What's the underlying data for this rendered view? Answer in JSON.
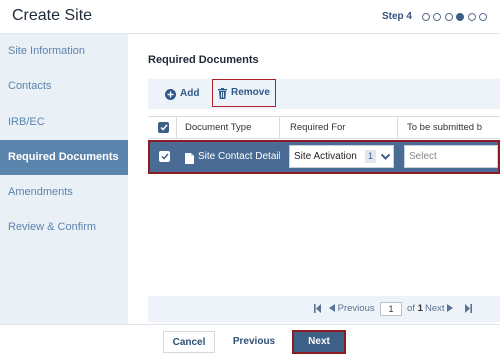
{
  "header": {
    "title": "Create Site",
    "step_label": "Step 4",
    "steps_total": 6,
    "current_step": 4
  },
  "sidebar": {
    "items": [
      {
        "label": "Site Information",
        "active": false
      },
      {
        "label": "Contacts",
        "active": false
      },
      {
        "label": "IRB/EC",
        "active": false
      },
      {
        "label": "Required Documents",
        "active": true
      },
      {
        "label": "Amendments",
        "active": false
      },
      {
        "label": "Review & Confirm",
        "active": false
      }
    ]
  },
  "main": {
    "section_title": "Required Documents",
    "toolbar": {
      "add_label": "Add",
      "add_icon": "plus-circle-icon",
      "remove_label": "Remove",
      "remove_icon": "trash-icon"
    },
    "table": {
      "columns": [
        "Document Type",
        "Required For",
        "To be submitted b"
      ],
      "header_checked": true,
      "rows": [
        {
          "checked": true,
          "document_icon": "document-icon",
          "document_type": "Site Contact Details",
          "required_for": "Site Activation",
          "required_for_count": "1",
          "submitted_by_placeholder": "Select"
        }
      ]
    },
    "pager": {
      "first_icon": "first-page-icon",
      "previous_label": "Previous",
      "page_value": "1",
      "of_label": "of",
      "total_pages": "1",
      "next_label": "Next",
      "last_icon": "last-page-icon"
    }
  },
  "footer": {
    "cancel_label": "Cancel",
    "previous_label": "Previous",
    "next_label": "Next"
  },
  "colors": {
    "accent": "#3f5f86",
    "sidebar_bg": "#e9f0f6",
    "highlight_border": "#8d1c22"
  }
}
